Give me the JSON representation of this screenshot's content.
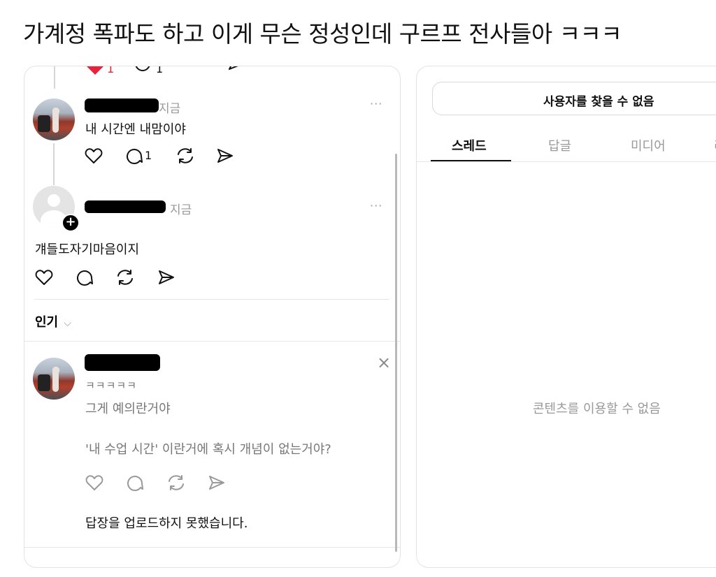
{
  "headline": "가계정 폭파도 하고 이게 무슨 정성인데 구르프 전사들아 ㅋㅋㅋ",
  "left": {
    "top_partial": {
      "like_count": "1",
      "reply_count": "1"
    },
    "post1": {
      "time": "지금",
      "text": "내 시간엔 내맘이야",
      "reply_count": "1",
      "more": "···"
    },
    "post2": {
      "time": "지금",
      "text": "걔들도자기마음이지",
      "more": "···"
    },
    "sort": {
      "label": "인기",
      "chevron": "⌵"
    },
    "reply": {
      "text1": "ㅋㅋㅋㅋㅋ",
      "text2": "그게 예의란거야",
      "text3": "'내 수업 시간' 이란거에 혹시 개념이 없는거야?",
      "status": "답장을 업로드하지 못했습니다.",
      "close": "×"
    }
  },
  "right": {
    "button": "사용자를 찾을 수 없음",
    "tabs": [
      "스레드",
      "답글",
      "미디어",
      "리"
    ],
    "active_tab": 0,
    "empty_message": "콘텐츠를 이용할 수 없음"
  },
  "colors": {
    "like_red": "#e8223d",
    "muted": "#999999",
    "border": "#e3e3e3"
  }
}
